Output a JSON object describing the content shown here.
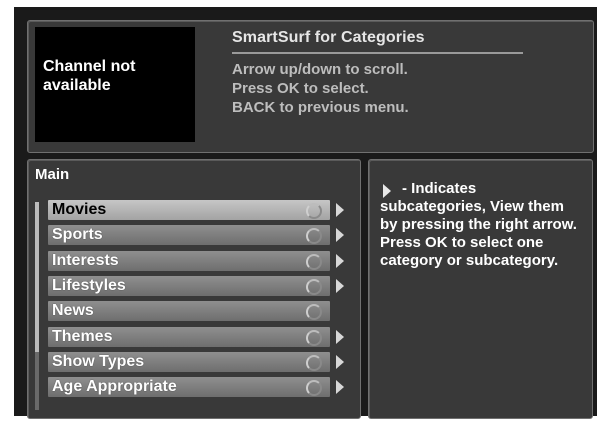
{
  "video": {
    "message": "Channel not available"
  },
  "header": {
    "title": "SmartSurf for Categories",
    "instructions": [
      "Arrow up/down to scroll.",
      "Press OK to select.",
      "BACK to previous menu."
    ]
  },
  "menu": {
    "title": "Main",
    "items": [
      {
        "label": "Movies",
        "selected": true,
        "has_subcategories": true
      },
      {
        "label": "Sports",
        "selected": false,
        "has_subcategories": true
      },
      {
        "label": "Interests",
        "selected": false,
        "has_subcategories": true
      },
      {
        "label": "Lifestyles",
        "selected": false,
        "has_subcategories": true
      },
      {
        "label": "News",
        "selected": false,
        "has_subcategories": false
      },
      {
        "label": "Themes",
        "selected": false,
        "has_subcategories": true
      },
      {
        "label": "Show Types",
        "selected": false,
        "has_subcategories": true
      },
      {
        "label": "Age Appropriate",
        "selected": false,
        "has_subcategories": true
      }
    ]
  },
  "help": {
    "first_line": "- Indicates",
    "body": "subcategories, View them by pressing the right arrow. Press OK to select one category or subcategory."
  },
  "icons": {
    "subcategory_indicator": "right-triangle-icon",
    "item_status": "ring-icon"
  },
  "colors": {
    "background": "#1a1a1a",
    "panel": "#393939",
    "item": "#7f7f7f",
    "item_selected": "#b5b5b5"
  }
}
